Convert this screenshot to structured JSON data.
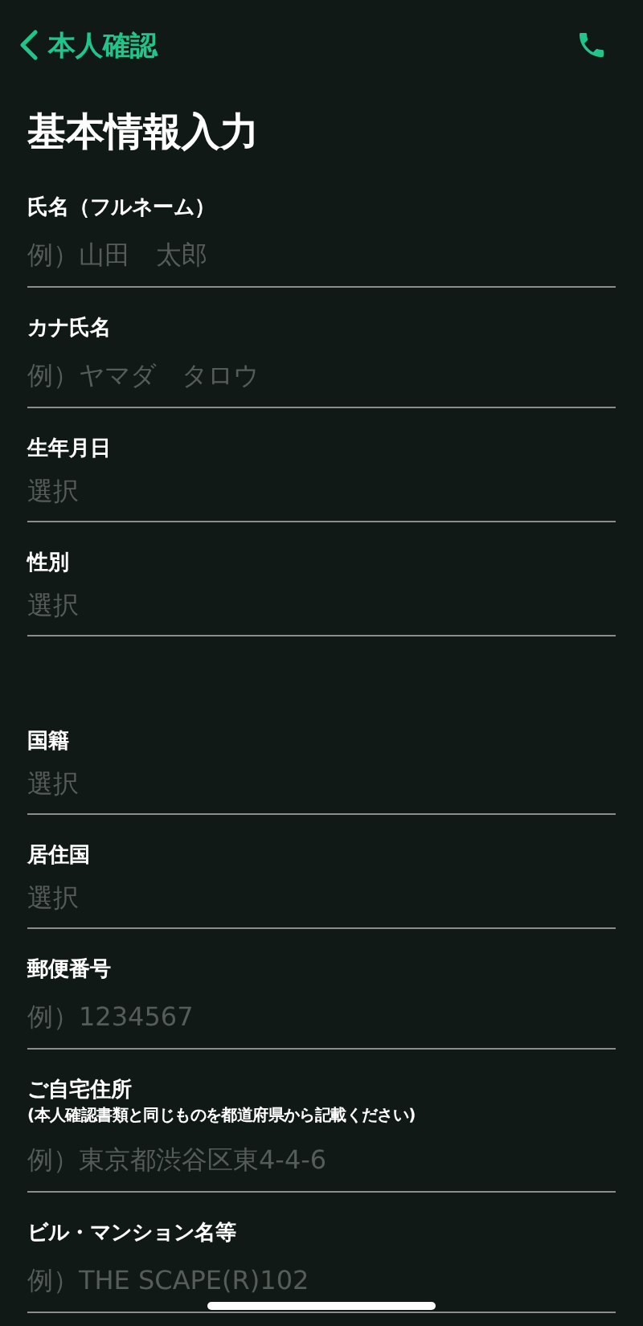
{
  "header": {
    "back_label": "本人確認"
  },
  "title": "基本情報入力",
  "sections": [
    {
      "fields": [
        {
          "kind": "text",
          "label": "氏名（フルネーム）",
          "placeholder": "例）山田　太郎"
        },
        {
          "kind": "text",
          "label": "カナ氏名",
          "placeholder": "例）ヤマダ　タロウ"
        },
        {
          "kind": "select",
          "label": "生年月日",
          "placeholder": "選択"
        },
        {
          "kind": "select",
          "label": "性別",
          "placeholder": "選択"
        }
      ]
    },
    {
      "fields": [
        {
          "kind": "select",
          "label": "国籍",
          "placeholder": "選択"
        },
        {
          "kind": "select",
          "label": "居住国",
          "placeholder": "選択"
        },
        {
          "kind": "text",
          "label": "郵便番号",
          "placeholder": "例）1234567"
        },
        {
          "kind": "text",
          "label": "ご自宅住所",
          "note": "(本人確認書類と同じものを都道府県から記載ください)",
          "placeholder": "例）東京都渋谷区東4-4-6"
        },
        {
          "kind": "text",
          "label": "ビル・マンション名等",
          "placeholder": "例）THE SCAPE(R)102"
        }
      ]
    }
  ]
}
